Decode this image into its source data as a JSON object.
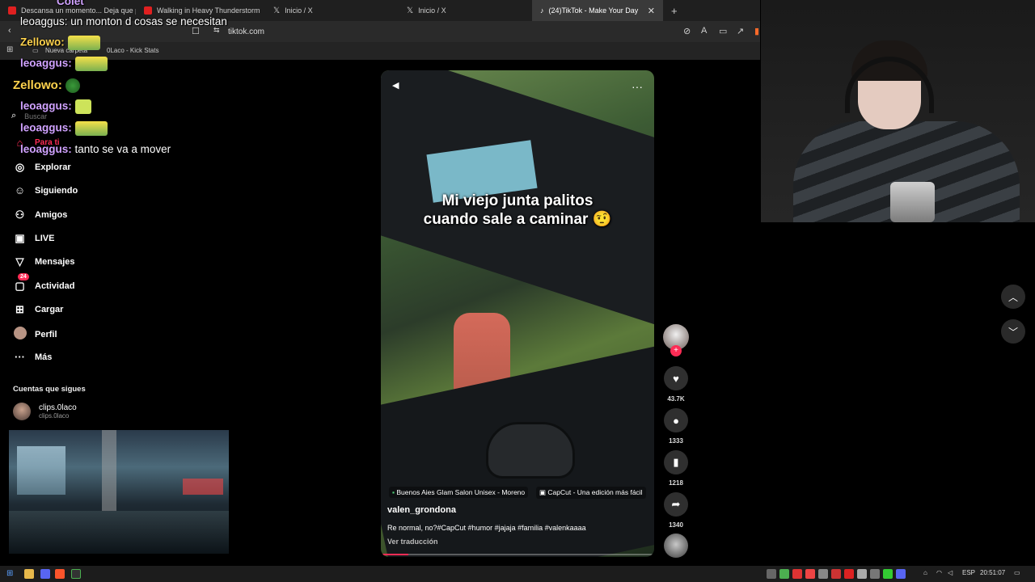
{
  "browser": {
    "tabs": [
      {
        "label": "Descansa un momento... Deja que p",
        "favicon_color": "#e02020"
      },
      {
        "label": "Walking in Heavy Thunderstorm",
        "favicon_color": "#e02020"
      },
      {
        "label": "Inicio / X",
        "favicon_color": "#ffffff"
      },
      {
        "label": "Inicio / X",
        "favicon_color": "#ffffff"
      },
      {
        "label": "(24)TikTok - Make Your Day",
        "favicon_color": "#ffffff",
        "active": true
      }
    ],
    "new_tab_icon": "plus-icon",
    "url": "tiktok.com",
    "bookmarks": [
      "Nueva carpeta",
      "0Laco - Kick Stats"
    ]
  },
  "stream_chat": [
    {
      "user": "Colet",
      "text": ""
    },
    {
      "user": "",
      "text": "leoaggus: un monton d cosas se necesitan"
    },
    {
      "user": "Zellowo:",
      "text": ""
    },
    {
      "user": "leoaggus:",
      "text": ""
    },
    {
      "user": "Zellowo:",
      "text": ""
    },
    {
      "user": "leoaggus:",
      "text": ""
    },
    {
      "user": "leoaggus:",
      "text": ""
    },
    {
      "user": "leoaggus:",
      "text": "tanto se va a mover"
    }
  ],
  "sidebar": {
    "search_placeholder": "Buscar",
    "items": [
      {
        "label": "Para ti",
        "icon": "home-icon",
        "active": true
      },
      {
        "label": "Explorar",
        "icon": "compass-icon"
      },
      {
        "label": "Siguiendo",
        "icon": "following-icon"
      },
      {
        "label": "Amigos",
        "icon": "friends-icon"
      },
      {
        "label": "LIVE",
        "icon": "live-icon"
      },
      {
        "label": "Mensajes",
        "icon": "messages-icon"
      },
      {
        "label": "Actividad",
        "icon": "activity-icon",
        "badge": "24"
      },
      {
        "label": "Cargar",
        "icon": "upload-icon"
      },
      {
        "label": "Perfil",
        "icon": "profile-icon"
      },
      {
        "label": "Más",
        "icon": "more-icon"
      }
    ],
    "following_title": "Cuentas que sigues",
    "following": [
      {
        "name": "clips.0laco",
        "handle": "clips.0laco"
      }
    ]
  },
  "video": {
    "caption_line1": "Mi viejo junta palitos",
    "caption_line2": "cuando sale a caminar 🤨",
    "location_tag": "Buenos Aies Glam Salon Unisex - Moreno",
    "capcut_tag": "CapCut - Una edición más fácil",
    "author": "valen_grondona",
    "description": "Re normal, no?#CapCut #humor #jajaja #familia #valenkaaaa",
    "translate": "Ver traducción",
    "progress": 0.1
  },
  "actions": {
    "likes": "43.7K",
    "comments": "1333",
    "saves": "1218",
    "shares": "1340"
  },
  "taskbar": {
    "lang": "ESP",
    "time": "20:51:07"
  }
}
